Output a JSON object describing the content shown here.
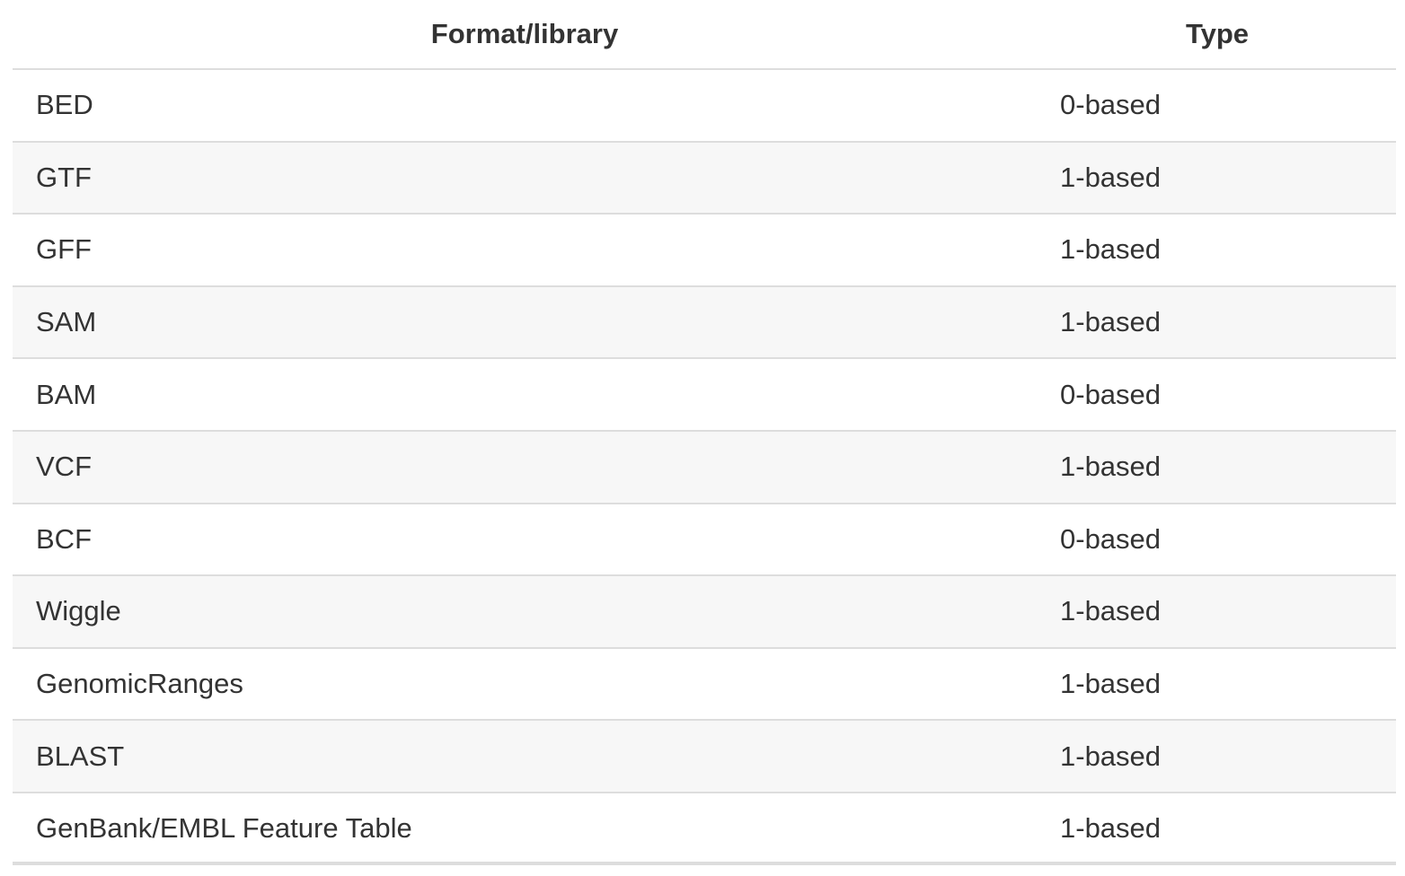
{
  "table": {
    "headers": [
      "Format/library",
      "Type"
    ],
    "rows": [
      {
        "format": "BED",
        "type": "0-based"
      },
      {
        "format": "GTF",
        "type": "1-based"
      },
      {
        "format": "GFF",
        "type": "1-based"
      },
      {
        "format": "SAM",
        "type": "1-based"
      },
      {
        "format": "BAM",
        "type": "0-based"
      },
      {
        "format": "VCF",
        "type": "1-based"
      },
      {
        "format": "BCF",
        "type": "0-based"
      },
      {
        "format": "Wiggle",
        "type": "1-based"
      },
      {
        "format": "GenomicRanges",
        "type": "1-based"
      },
      {
        "format": "BLAST",
        "type": "1-based"
      },
      {
        "format": "GenBank/EMBL Feature Table",
        "type": "1-based"
      }
    ]
  }
}
